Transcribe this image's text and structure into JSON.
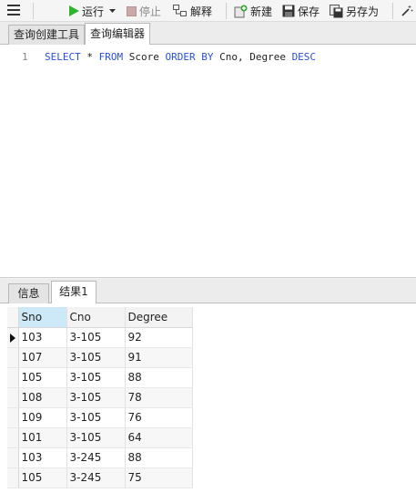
{
  "toolbar": {
    "run": "运行",
    "stop": "停止",
    "explain": "解释",
    "new": "新建",
    "save": "保存",
    "save_as": "另存为"
  },
  "editor_tabs": [
    "查询创建工具",
    "查询编辑器"
  ],
  "editor": {
    "line_number": "1",
    "sql": {
      "select": "SELECT",
      "star": " * ",
      "from": "FROM",
      "table": " Score ",
      "order_by": "ORDER BY",
      "cols": " Cno, Degree ",
      "desc": "DESC"
    }
  },
  "result_tabs": [
    "信息",
    "结果1"
  ],
  "grid": {
    "columns": [
      "Sno",
      "Cno",
      "Degree"
    ],
    "rows": [
      [
        "103",
        "3-105",
        "92"
      ],
      [
        "107",
        "3-105",
        "91"
      ],
      [
        "105",
        "3-105",
        "88"
      ],
      [
        "108",
        "3-105",
        "78"
      ],
      [
        "109",
        "3-105",
        "76"
      ],
      [
        "101",
        "3-105",
        "64"
      ],
      [
        "103",
        "3-245",
        "88"
      ],
      [
        "105",
        "3-245",
        "75"
      ]
    ]
  },
  "colors": {
    "keyword": "#2a4fd6",
    "run_icon": "#2db52d",
    "selected_header": "#cde8f6"
  }
}
